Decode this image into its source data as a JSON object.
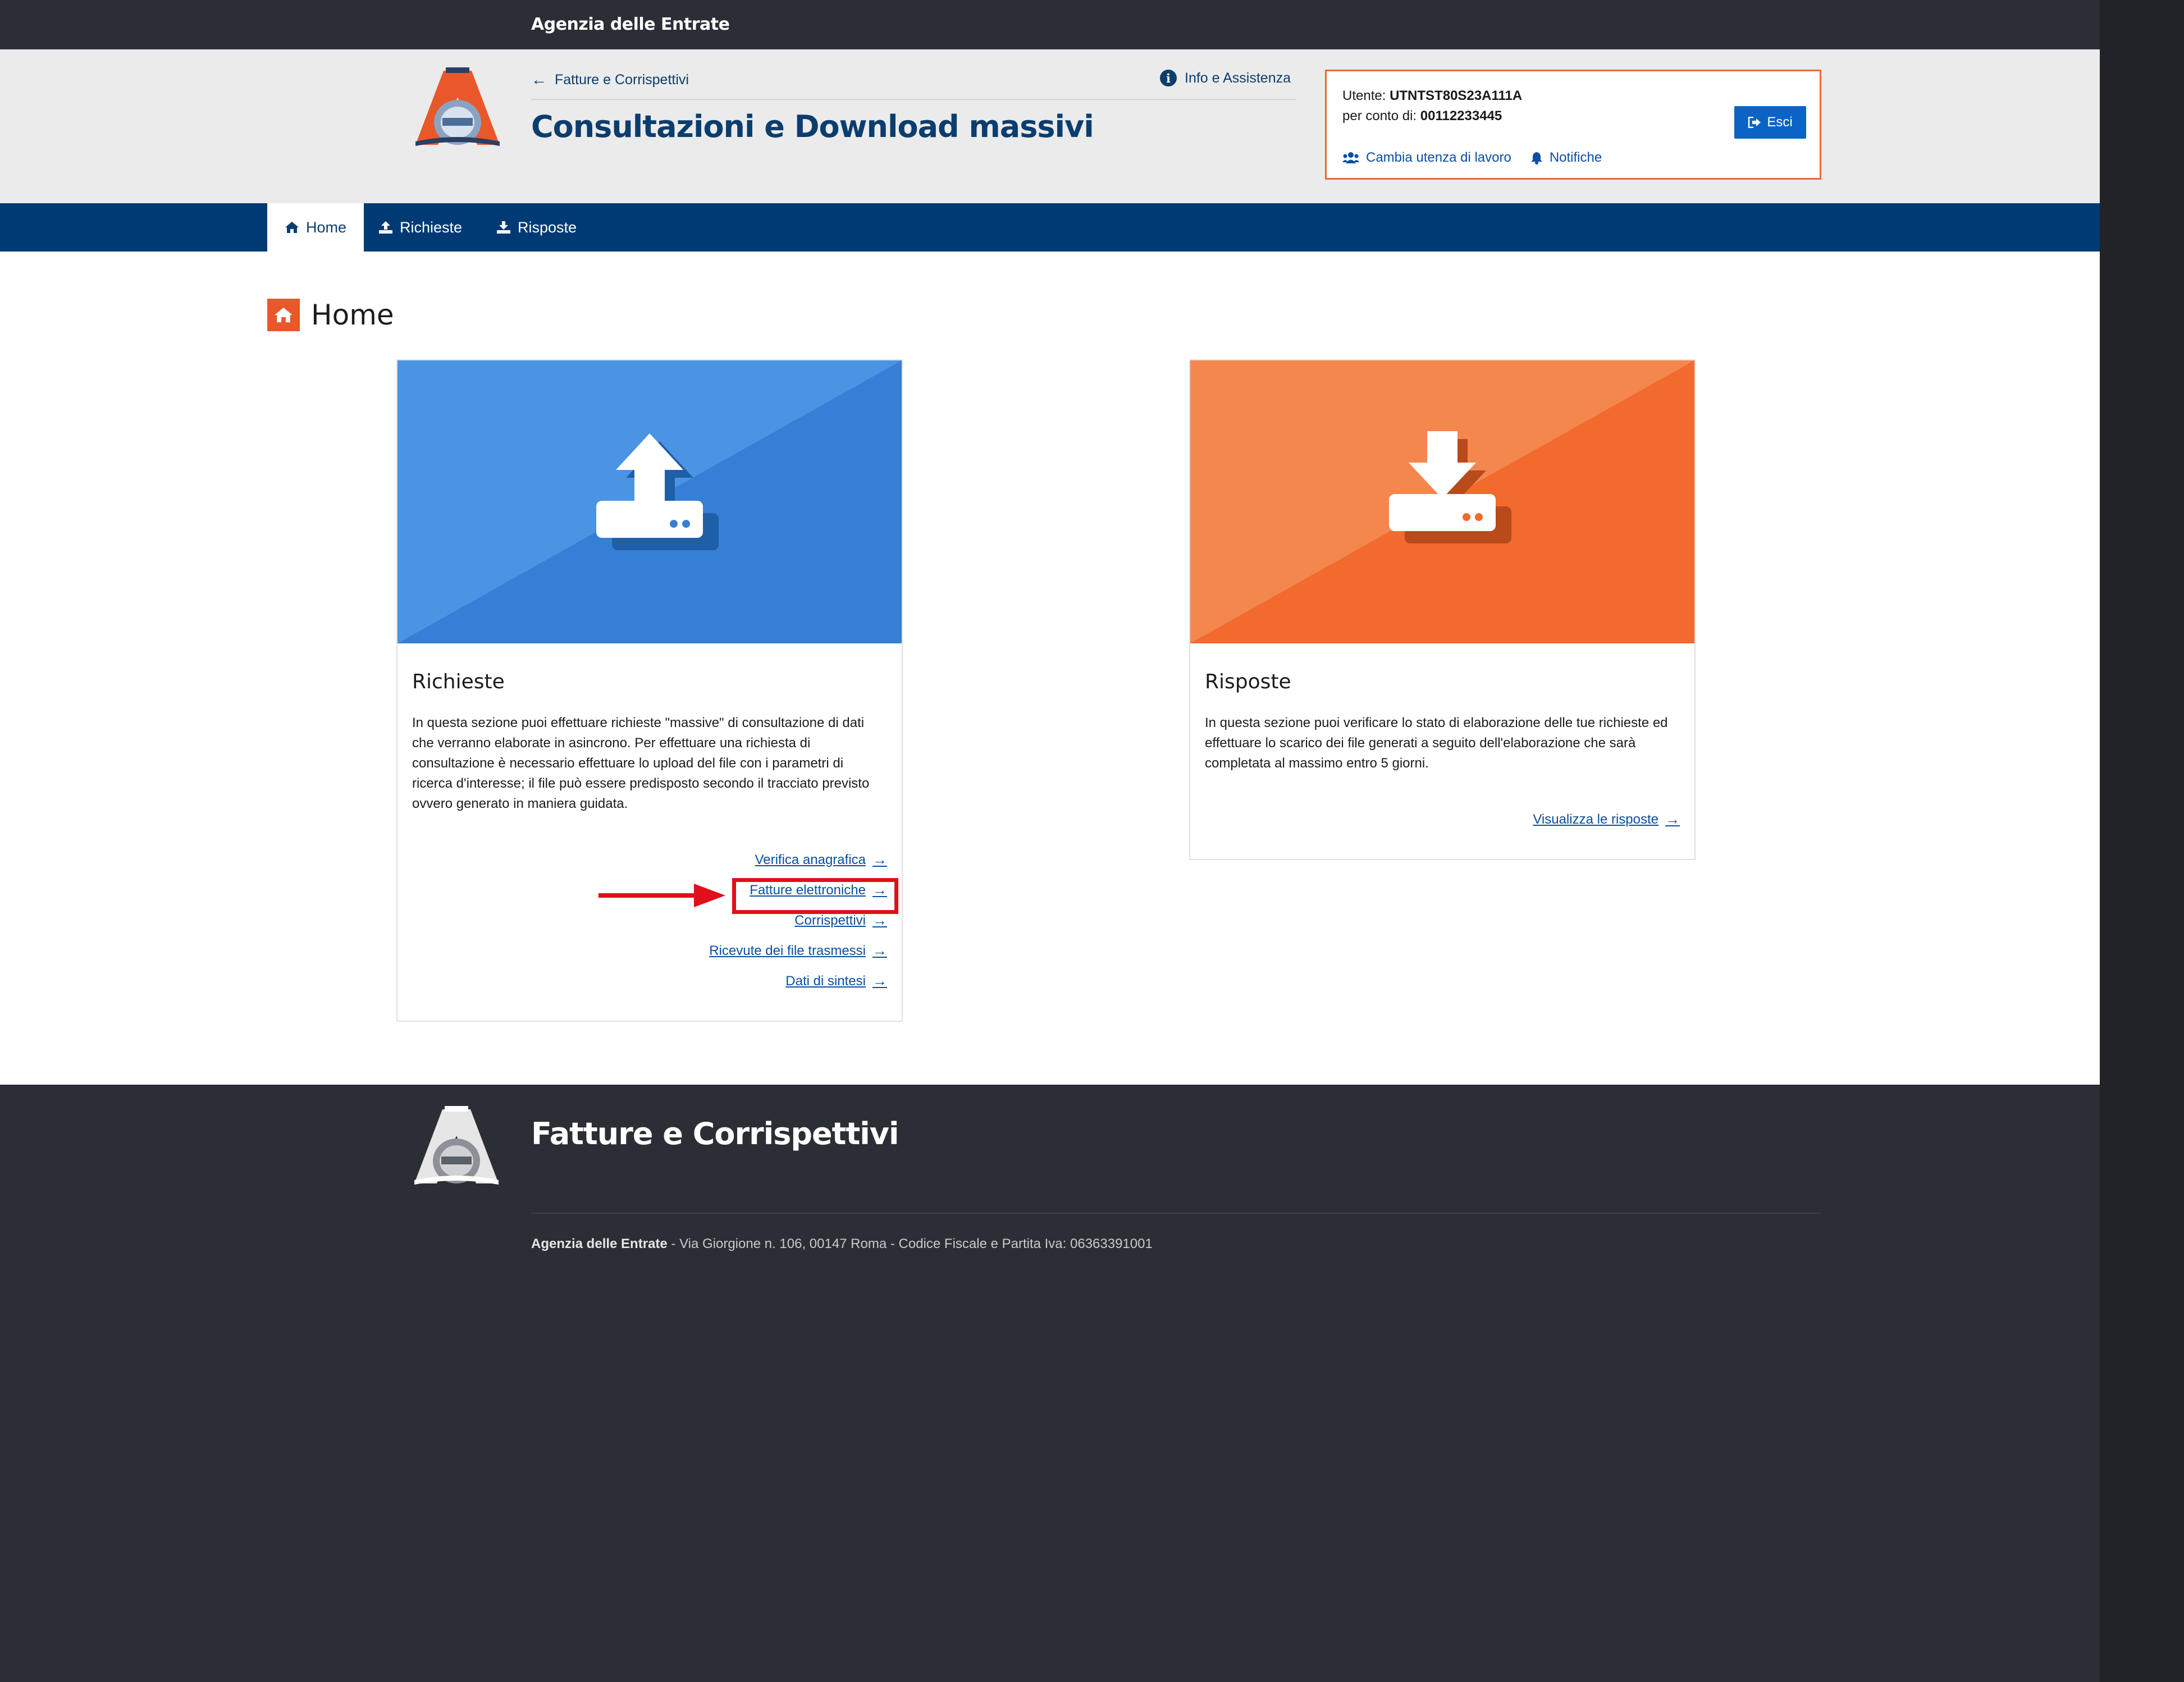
{
  "topbar": {
    "agency": "Agenzia delle Entrate"
  },
  "header": {
    "breadcrumb": "Fatture e Corrispettivi",
    "info": "Info e Assistenza",
    "title": "Consultazioni e Download massivi"
  },
  "user": {
    "utente_label": "Utente:",
    "utente_value": "UTNTST80S23A111A",
    "conto_label": "per conto di:",
    "conto_value": "00112233445",
    "change_label": "Cambia utenza di lavoro",
    "notifications_label": "Notifiche",
    "logout_label": "Esci"
  },
  "nav": {
    "tabs": [
      {
        "label": "Home",
        "icon": "home-icon",
        "active": true
      },
      {
        "label": "Richieste",
        "icon": "upload-icon",
        "active": false
      },
      {
        "label": "Risposte",
        "icon": "download-icon",
        "active": false
      }
    ]
  },
  "main": {
    "page_title": "Home",
    "cards": [
      {
        "title": "Richieste",
        "icon": "upload-tray-icon",
        "color_light": "#4a94e3",
        "color_dark": "#3580d6",
        "description": "In questa sezione puoi effettuare richieste \"massive\" di consultazione di dati che verranno elaborate in asincrono. Per effettuare una richiesta di consultazione è necessario effettuare lo upload del file con i parametri di ricerca d'interesse; il file può essere predisposto secondo il tracciato previsto ovvero generato in maniera guidata.",
        "links": [
          "Verifica anagrafica",
          "Fatture elettroniche",
          "Corrispettivi",
          "Ricevute dei file trasmessi",
          "Dati di sintesi"
        ]
      },
      {
        "title": "Risposte",
        "icon": "download-tray-icon",
        "color_light": "#f3874d",
        "color_dark": "#f26a2e",
        "description": "In questa sezione puoi verificare lo stato di elaborazione delle tue richieste ed effettuare lo scarico dei file generati a seguito dell'elaborazione che sarà completata al massimo entro 5 giorni.",
        "links": [
          "Visualizza le risposte"
        ]
      }
    ]
  },
  "footer": {
    "title": "Fatture e Corrispettivi",
    "address_strong": "Agenzia delle Entrate",
    "address_rest": " - Via Giorgione n. 106, 00147 Roma - Codice Fiscale e Partita Iva: 06363391001"
  },
  "colors": {
    "navy": "#003a75",
    "accent_orange": "#e8582a",
    "highlight_red": "#e0101a",
    "link_blue": "#0b4ea2"
  }
}
